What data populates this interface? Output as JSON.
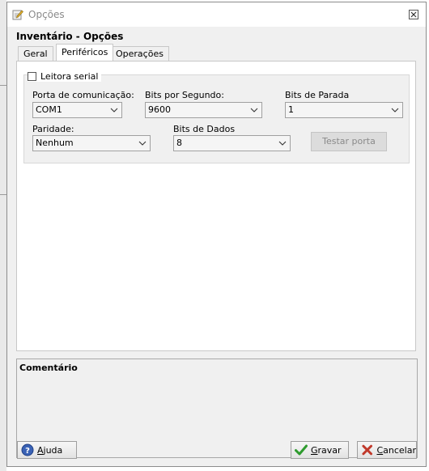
{
  "window": {
    "title": "Opções",
    "close_glyph": "⊠"
  },
  "form": {
    "heading": "Inventário - Opções"
  },
  "tabs": [
    {
      "label": "Geral"
    },
    {
      "label": "Periféricos",
      "active": true
    },
    {
      "label": "Operações"
    }
  ],
  "serial": {
    "checkbox_label": "Leitora serial",
    "checked": false,
    "port_label": "Porta de comunicação:",
    "port_value": "COM1",
    "baud_label": "Bits por Segundo:",
    "baud_value": "9600",
    "stop_label": "Bits de Parada",
    "stop_value": "1",
    "parity_label": "Paridade:",
    "parity_value": "Nenhum",
    "data_bits_label": "Bits de Dados",
    "data_bits_value": "8",
    "test_button": "Testar porta"
  },
  "comment": {
    "title": "Comentário"
  },
  "footer": {
    "help_access": "A",
    "help_rest": "juda",
    "save_access": "G",
    "save_rest": "ravar",
    "cancel_access": "C",
    "cancel_rest": "ancelar"
  },
  "colors": {
    "help_icon": "#3a62b5",
    "save_icon": "#2e9b2e",
    "cancel_icon": "#c0392b"
  }
}
